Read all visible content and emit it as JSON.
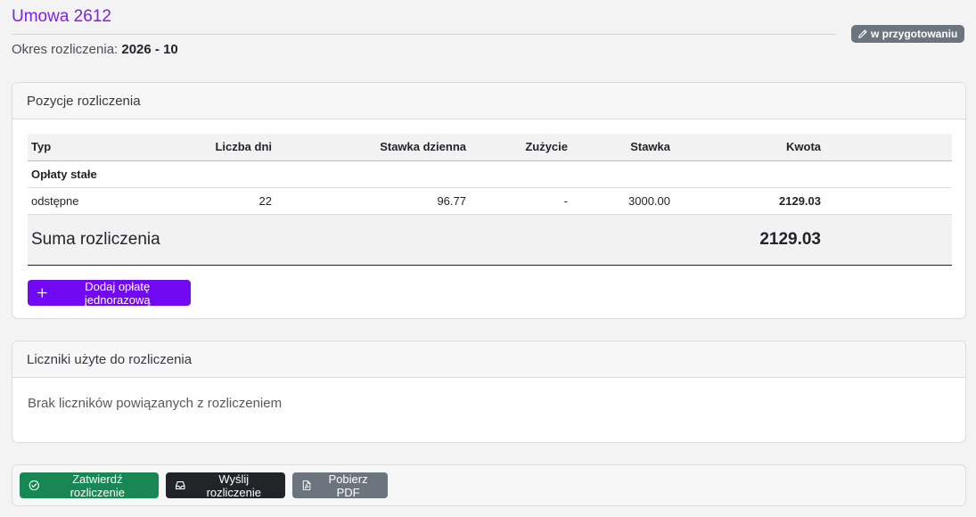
{
  "header": {
    "title": "Umowa 2612",
    "period_label": "Okres rozliczenia:",
    "period_value": "2026 - 10",
    "status_badge": "w przygotowaniu"
  },
  "positions": {
    "card_title": "Pozycje rozliczenia",
    "columns": [
      "Typ",
      "Liczba dni",
      "Stawka dzienna",
      "Zużycie",
      "Stawka",
      "Kwota"
    ],
    "group_label": "Opłaty stałe",
    "rows": [
      {
        "type": "odstępne",
        "days": "22",
        "daily_rate": "96.77",
        "usage": "-",
        "rate": "3000.00",
        "amount": "2129.03"
      }
    ],
    "sum_label": "Suma rozliczenia",
    "sum_value": "2129.03",
    "add_button": "Dodaj opłatę jednorazową"
  },
  "meters": {
    "card_title": "Liczniki użyte do rozliczenia",
    "empty_text": "Brak liczników powiązanych z rozliczeniem"
  },
  "actions": {
    "approve": "Zatwierdź rozliczenie",
    "send": "Wyślij rozliczenie",
    "pdf": "Pobierz PDF"
  },
  "colors": {
    "accent": "#7209f3",
    "title": "#7c22e8",
    "approve": "#198754",
    "send": "#212529",
    "secondary": "#6c757d"
  }
}
